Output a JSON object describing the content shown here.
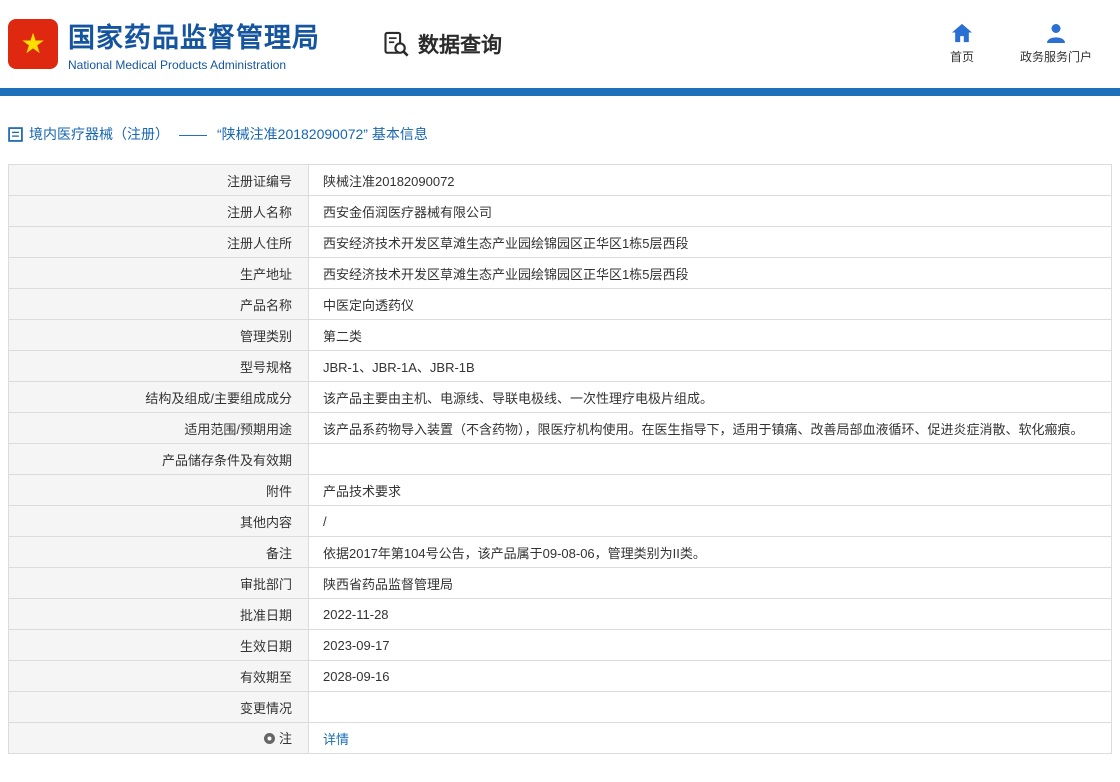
{
  "header": {
    "agency_cn": "国家药品监督管理局",
    "agency_en": "National Medical Products Administration",
    "query_title": "数据查询",
    "nav_home": "首页",
    "nav_portal": "政务服务门户"
  },
  "breadcrumb": {
    "section": "境内医疗器械（注册）",
    "dash": "——",
    "detail": "“陕械注准20182090072” 基本信息"
  },
  "table": {
    "rows": [
      {
        "label": "注册证编号",
        "value": "陕械注准20182090072"
      },
      {
        "label": "注册人名称",
        "value": "西安金佰润医疗器械有限公司"
      },
      {
        "label": "注册人住所",
        "value": "西安经济技术开发区草滩生态产业园绘锦园区正华区1栋5层西段"
      },
      {
        "label": "生产地址",
        "value": "西安经济技术开发区草滩生态产业园绘锦园区正华区1栋5层西段"
      },
      {
        "label": "产品名称",
        "value": "中医定向透药仪"
      },
      {
        "label": "管理类别",
        "value": "第二类"
      },
      {
        "label": "型号规格",
        "value": "JBR-1、JBR-1A、JBR-1B"
      },
      {
        "label": "结构及组成/主要组成成分",
        "value": "该产品主要由主机、电源线、导联电极线、一次性理疗电极片组成。"
      },
      {
        "label": "适用范围/预期用途",
        "value": "该产品系药物导入装置（不含药物），限医疗机构使用。在医生指导下，适用于镇痛、改善局部血液循环、促进炎症消散、软化瘢痕。"
      },
      {
        "label": "产品储存条件及有效期",
        "value": ""
      },
      {
        "label": "附件",
        "value": "产品技术要求"
      },
      {
        "label": "其他内容",
        "value": "/"
      },
      {
        "label": "备注",
        "value": "依据2017年第104号公告，该产品属于09-08-06，管理类别为II类。"
      },
      {
        "label": "审批部门",
        "value": "陕西省药品监督管理局"
      },
      {
        "label": "批准日期",
        "value": "2022-11-28"
      },
      {
        "label": "生效日期",
        "value": "2023-09-17"
      },
      {
        "label": "有效期至",
        "value": "2028-09-16"
      },
      {
        "label": "变更情况",
        "value": ""
      },
      {
        "label": "注",
        "value": "详情"
      }
    ]
  },
  "colors": {
    "brand_blue": "#15559f",
    "bar_blue": "#1d70b9",
    "link_blue": "#1b6db8",
    "emblem_red": "#de2910",
    "emblem_gold": "#ffde00"
  }
}
